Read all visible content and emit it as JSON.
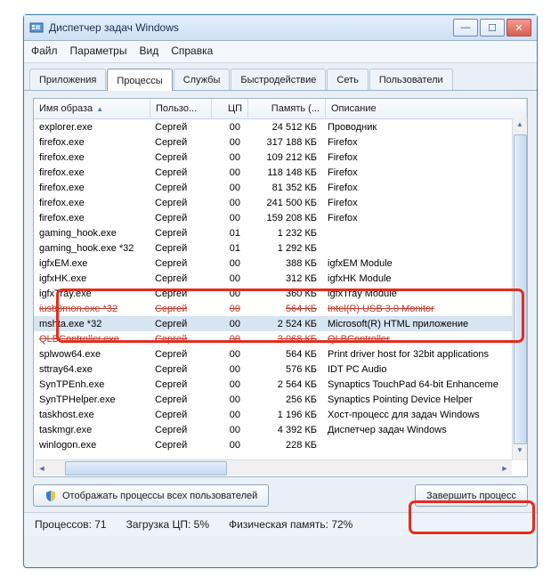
{
  "window": {
    "title": "Диспетчер задач Windows"
  },
  "menu": {
    "file": "Файл",
    "options": "Параметры",
    "view": "Вид",
    "help": "Справка"
  },
  "tabs": {
    "applications": "Приложения",
    "processes": "Процессы",
    "services": "Службы",
    "performance": "Быстродействие",
    "network": "Сеть",
    "users": "Пользователи"
  },
  "columns": {
    "image": "Имя образа",
    "user": "Пользо...",
    "cpu": "ЦП",
    "memory": "Память (...",
    "description": "Описание"
  },
  "processes": [
    {
      "image": "explorer.exe",
      "user": "Сергей",
      "cpu": "00",
      "mem": "24 512 КБ",
      "desc": "Проводник"
    },
    {
      "image": "firefox.exe",
      "user": "Сергей",
      "cpu": "00",
      "mem": "317 188 КБ",
      "desc": "Firefox"
    },
    {
      "image": "firefox.exe",
      "user": "Сергей",
      "cpu": "00",
      "mem": "109 212 КБ",
      "desc": "Firefox"
    },
    {
      "image": "firefox.exe",
      "user": "Сергей",
      "cpu": "00",
      "mem": "118 148 КБ",
      "desc": "Firefox"
    },
    {
      "image": "firefox.exe",
      "user": "Сергей",
      "cpu": "00",
      "mem": "81 352 КБ",
      "desc": "Firefox"
    },
    {
      "image": "firefox.exe",
      "user": "Сергей",
      "cpu": "00",
      "mem": "241 500 КБ",
      "desc": "Firefox"
    },
    {
      "image": "firefox.exe",
      "user": "Сергей",
      "cpu": "00",
      "mem": "159 208 КБ",
      "desc": "Firefox"
    },
    {
      "image": "gaming_hook.exe",
      "user": "Сергей",
      "cpu": "01",
      "mem": "1 232 КБ",
      "desc": ""
    },
    {
      "image": "gaming_hook.exe *32",
      "user": "Сергей",
      "cpu": "01",
      "mem": "1 292 КБ",
      "desc": ""
    },
    {
      "image": "igfxEM.exe",
      "user": "Сергей",
      "cpu": "00",
      "mem": "388 КБ",
      "desc": "igfxEM Module"
    },
    {
      "image": "igfxHK.exe",
      "user": "Сергей",
      "cpu": "00",
      "mem": "312 КБ",
      "desc": "igfxHK Module"
    },
    {
      "image": "igfxTray.exe",
      "user": "Сергей",
      "cpu": "00",
      "mem": "360 КБ",
      "desc": "igfxTray Module"
    },
    {
      "image": "iusb3mon.exe *32",
      "user": "Сергей",
      "cpu": "00",
      "mem": "564 КБ",
      "desc": "Intel(R) USB 3.0 Monitor",
      "strike": true
    },
    {
      "image": "mshta.exe *32",
      "user": "Сергей",
      "cpu": "00",
      "mem": "2 524 КБ",
      "desc": "Microsoft(R) HTML приложение",
      "selected": true
    },
    {
      "image": "QLBController.exe",
      "user": "Сергей",
      "cpu": "00",
      "mem": "3 068 КБ",
      "desc": "QLBController",
      "strike": true
    },
    {
      "image": "splwow64.exe",
      "user": "Сергей",
      "cpu": "00",
      "mem": "564 КБ",
      "desc": "Print driver host for 32bit applications"
    },
    {
      "image": "sttray64.exe",
      "user": "Сергей",
      "cpu": "00",
      "mem": "576 КБ",
      "desc": "IDT PC Audio"
    },
    {
      "image": "SynTPEnh.exe",
      "user": "Сергей",
      "cpu": "00",
      "mem": "2 564 КБ",
      "desc": "Synaptics TouchPad 64-bit Enhanceme"
    },
    {
      "image": "SynTPHelper.exe",
      "user": "Сергей",
      "cpu": "00",
      "mem": "256 КБ",
      "desc": "Synaptics Pointing Device Helper"
    },
    {
      "image": "taskhost.exe",
      "user": "Сергей",
      "cpu": "00",
      "mem": "1 196 КБ",
      "desc": "Хост-процесс для задач Windows"
    },
    {
      "image": "taskmgr.exe",
      "user": "Сергей",
      "cpu": "00",
      "mem": "4 392 КБ",
      "desc": "Диспетчер задач Windows"
    },
    {
      "image": "winlogon.exe",
      "user": "Сергей",
      "cpu": "00",
      "mem": "228 КБ",
      "desc": ""
    }
  ],
  "buttons": {
    "show_all": "Отображать процессы всех пользователей",
    "end_process": "Завершить процесс"
  },
  "status": {
    "processes_label": "Процессов:",
    "processes_value": "71",
    "cpu_label": "Загрузка ЦП:",
    "cpu_value": "5%",
    "mem_label": "Физическая память:",
    "mem_value": "72%"
  }
}
